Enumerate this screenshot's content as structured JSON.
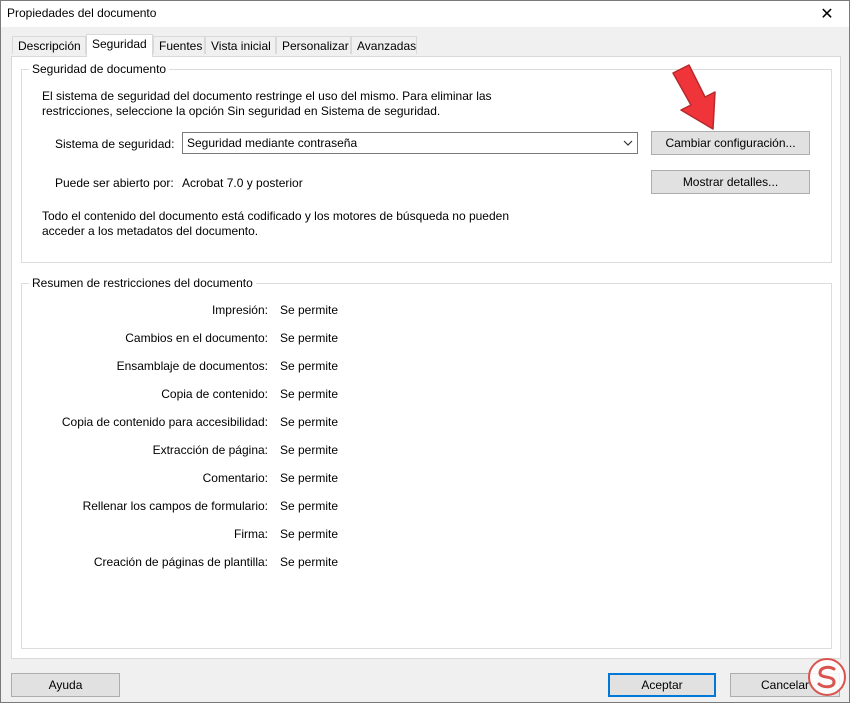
{
  "window": {
    "title": "Propiedades del documento",
    "close_glyph": "✕"
  },
  "tabs": [
    {
      "label": "Descripción",
      "active": false
    },
    {
      "label": "Seguridad",
      "active": true
    },
    {
      "label": "Fuentes",
      "active": false
    },
    {
      "label": "Vista inicial",
      "active": false
    },
    {
      "label": "Personalizar",
      "active": false
    },
    {
      "label": "Avanzadas",
      "active": false
    }
  ],
  "security": {
    "group_label": "Seguridad de documento",
    "intro_line1": "El sistema de seguridad del documento restringe el uso del mismo. Para eliminar las",
    "intro_line2": "restricciones, seleccione la opción Sin seguridad en Sistema de seguridad.",
    "system_label": "Sistema de seguridad:",
    "system_value": "Seguridad mediante contraseña",
    "change_button": "Cambiar configuración...",
    "opened_by_label": "Puede ser abierto por:",
    "opened_by_value": "Acrobat 7.0 y posterior",
    "details_button": "Mostrar detalles...",
    "note_line1": "Todo el contenido del documento está codificado y los motores de búsqueda no pueden",
    "note_line2": "acceder a los metadatos del documento."
  },
  "restrictions": {
    "group_label": "Resumen de restricciones del documento",
    "rows": [
      {
        "label": "Impresión:",
        "value": "Se permite"
      },
      {
        "label": "Cambios en el documento:",
        "value": "Se permite"
      },
      {
        "label": "Ensamblaje de documentos:",
        "value": "Se permite"
      },
      {
        "label": "Copia de contenido:",
        "value": "Se permite"
      },
      {
        "label": "Copia de contenido para accesibilidad:",
        "value": "Se permite"
      },
      {
        "label": "Extracción de página:",
        "value": "Se permite"
      },
      {
        "label": "Comentario:",
        "value": "Se permite"
      },
      {
        "label": "Rellenar los campos de formulario:",
        "value": "Se permite"
      },
      {
        "label": "Firma:",
        "value": "Se permite"
      },
      {
        "label": "Creación de páginas de plantilla:",
        "value": "Se permite"
      }
    ]
  },
  "footer": {
    "help_button": "Ayuda",
    "ok_button": "Aceptar",
    "cancel_button": "Cancelar"
  },
  "colors": {
    "annotation_arrow": "#f0353a",
    "default_button_border": "#0078d7",
    "watermark": "#d9534f"
  },
  "icons": {
    "close": "close-icon",
    "dropdown": "chevron-down-icon",
    "annotation": "red-arrow-icon",
    "watermark": "watermark-logo-icon"
  }
}
